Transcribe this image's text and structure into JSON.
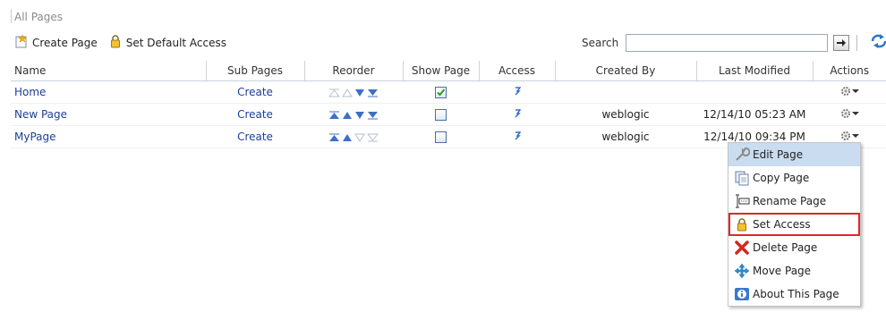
{
  "breadcrumb": "All Pages",
  "toolbar": {
    "create_page": "Create Page",
    "set_default_access": "Set Default Access"
  },
  "search": {
    "label": "Search",
    "value": ""
  },
  "table": {
    "columns": [
      "Name",
      "Sub Pages",
      "Reorder",
      "Show Page",
      "Access",
      "Created By",
      "Last Modified",
      "Actions"
    ],
    "rows": [
      {
        "name": "Home",
        "sub_pages": "Create",
        "show_page": true,
        "created_by": "",
        "last_modified": ""
      },
      {
        "name": "New Page",
        "sub_pages": "Create",
        "show_page": false,
        "created_by": "weblogic",
        "last_modified": "12/14/10 05:23 AM"
      },
      {
        "name": "MyPage",
        "sub_pages": "Create",
        "show_page": false,
        "created_by": "weblogic",
        "last_modified": "12/14/10 09:34 PM"
      }
    ]
  },
  "menu": {
    "items": [
      {
        "label": "Edit Page",
        "icon": "wrench-icon"
      },
      {
        "label": "Copy Page",
        "icon": "copy-icon"
      },
      {
        "label": "Rename Page",
        "icon": "rename-icon"
      },
      {
        "label": "Set Access",
        "icon": "lock-icon"
      },
      {
        "label": "Delete Page",
        "icon": "delete-icon"
      },
      {
        "label": "Move Page",
        "icon": "move-icon"
      },
      {
        "label": "About This Page",
        "icon": "info-icon"
      }
    ]
  },
  "colors": {
    "link": "#1c3f95",
    "highlight": "#c9dcf0",
    "red_outline": "#e3262a"
  }
}
